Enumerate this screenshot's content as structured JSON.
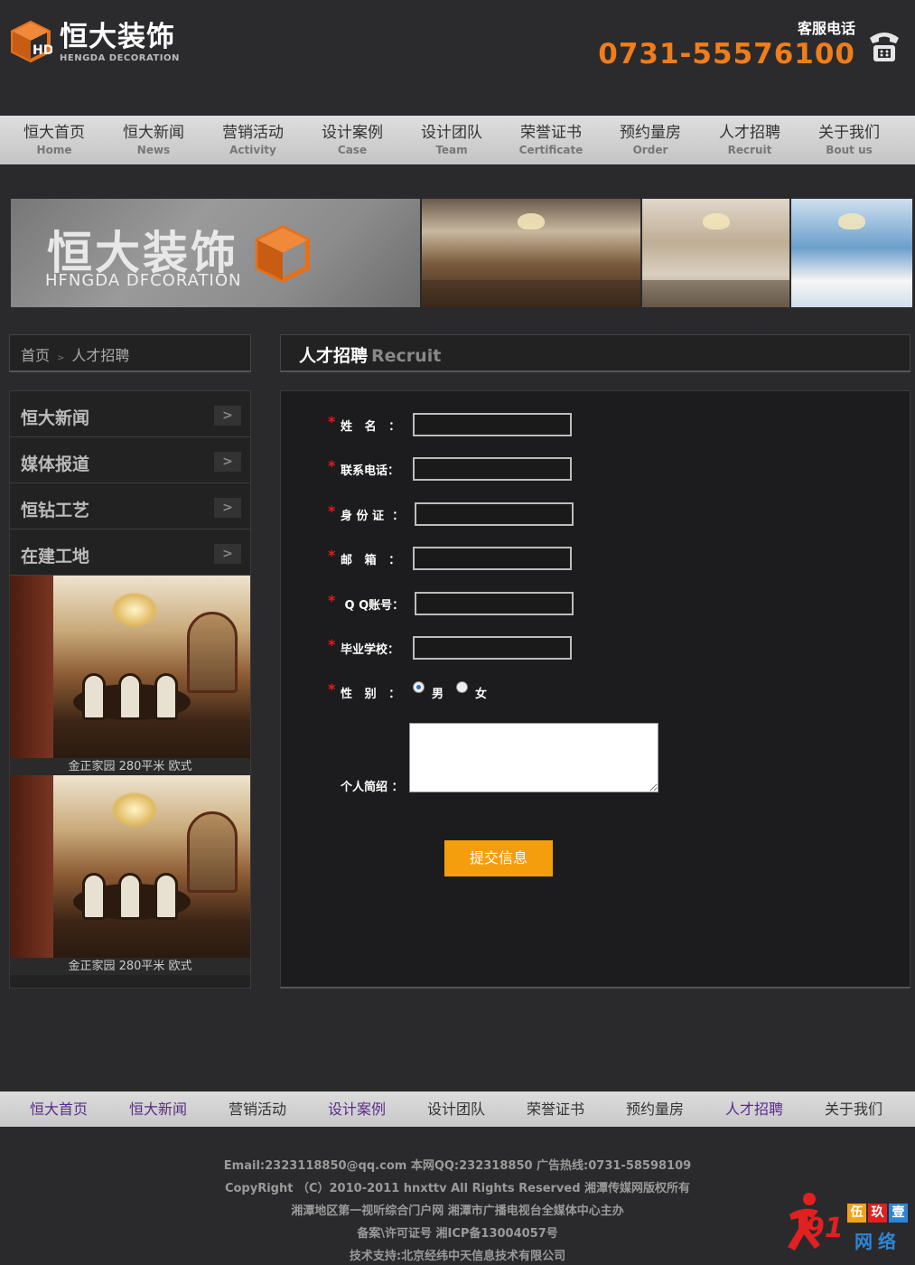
{
  "header": {
    "logo_cn": "恒大装饰",
    "logo_en": "HENGDA DECORATION",
    "hotline_label": "客服电话",
    "hotline_number": "0731-55576100"
  },
  "nav": [
    {
      "cn": "恒大首页",
      "en": "Home"
    },
    {
      "cn": "恒大新闻",
      "en": "News"
    },
    {
      "cn": "营销活动",
      "en": "Activity"
    },
    {
      "cn": "设计案例",
      "en": "Case"
    },
    {
      "cn": "设计团队",
      "en": "Team"
    },
    {
      "cn": "荣誉证书",
      "en": "Certificate"
    },
    {
      "cn": "预约量房",
      "en": "Order"
    },
    {
      "cn": "人才招聘",
      "en": "Recruit"
    },
    {
      "cn": "关于我们",
      "en": "Bout us"
    }
  ],
  "banner": {
    "title_cn": "恒大装饰",
    "title_en": "HFNGDA DFCORATION"
  },
  "breadcrumb": {
    "home": "首页",
    "sep": ">",
    "current": "人才招聘"
  },
  "section": {
    "title_cn": "人才招聘",
    "title_en": "Recruit"
  },
  "sidebar": {
    "items": [
      "恒大新闻",
      "媒体报道",
      "恒钻工艺",
      "在建工地"
    ],
    "arrow": ">",
    "cases": [
      {
        "caption": "金正家园 280平米 欧式"
      },
      {
        "caption": "金正家园 280平米 欧式"
      }
    ]
  },
  "form": {
    "required_mark": "*",
    "fields": [
      {
        "label": "姓   名   ："
      },
      {
        "label": "联系电话："
      },
      {
        "label": "身 份 证  ："
      },
      {
        "label": "邮   箱   ："
      },
      {
        "label": " Q Q账号："
      },
      {
        "label": "毕业学校："
      }
    ],
    "gender_label": "性   别   ：",
    "gender_options": [
      "男",
      "女"
    ],
    "gender_selected": "男",
    "intro_label": "个人简绍 ：",
    "submit_label": "提交信息"
  },
  "footer_nav": [
    "恒大首页",
    "恒大新闻",
    "营销活动",
    "设计案例",
    "设计团队",
    "荣誉证书",
    "预约量房",
    "人才招聘",
    "关于我们"
  ],
  "footer_lines": [
    "Email:2323118850@qq.com  本网QQ:232318850  广告热线:0731-58598109",
    "CopyRight  （C）2010-2011  hnxttv  All  Rights  Reserved  湘潭传媒网版权所有",
    "湘潭地区第一视听综合门户网   湘潭市广播电视台全媒体中心主办",
    "备案\\许可证号  湘ICP备13004057号",
    "技术支持:北京经纬中天信息技术有限公司"
  ],
  "badge": {
    "number": "91",
    "chars": [
      "伍",
      "玖",
      "壹"
    ],
    "net": "网络"
  },
  "colors": {
    "accent_orange": "#f07d1a",
    "submit_orange": "#f49e0d",
    "required_red": "#e21b1b",
    "footer_link_purple": "#5a2b8a"
  }
}
